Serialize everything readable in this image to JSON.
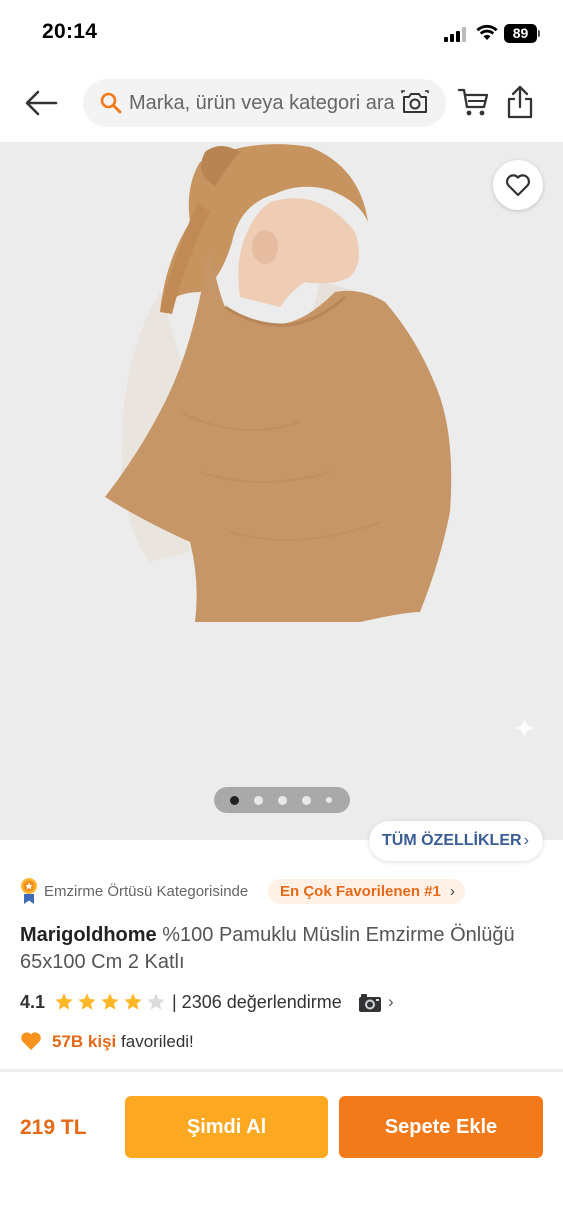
{
  "status_bar": {
    "time": "20:14",
    "battery": "89"
  },
  "header": {
    "search_placeholder": "Marka, ürün veya kategori ara",
    "icons": [
      "back-arrow-icon",
      "search-icon",
      "camera-icon",
      "cart-icon",
      "share-icon"
    ]
  },
  "gallery": {
    "image_count": 5,
    "active_index": 0,
    "favorite_icon": "heart-outline-icon"
  },
  "features_button": {
    "label": "TÜM ÖZELLİKLER",
    "chevron": "›"
  },
  "ranking": {
    "category_text": "Emzirme Örtüsü Kategorisinde",
    "badge_text": "En Çok Favorilenen #1",
    "chevron": "›",
    "icon": "award-icon"
  },
  "product": {
    "brand": "Marigoldhome",
    "name": "%100 Pamuklu Müslin Emzirme Önlüğü 65x100 Cm 2 Katlı"
  },
  "rating": {
    "value": "4.1",
    "stars_filled": 4,
    "stars_total": 5,
    "count_text": "| 2306 değerlendirme",
    "chevron": "›"
  },
  "favorites": {
    "count": "57B",
    "unit": "kişi",
    "text": "favoriledi!",
    "icon": "orange-heart-icon"
  },
  "bottom_bar": {
    "price": "219 TL",
    "buy_now_label": "Şimdi Al",
    "add_to_cart_label": "Sepete Ekle"
  },
  "colors": {
    "brand_orange": "#f27a1a",
    "buy_now_yellow": "#fca821",
    "link_blue": "#3a5d94",
    "star_yellow": "#fdb727"
  }
}
